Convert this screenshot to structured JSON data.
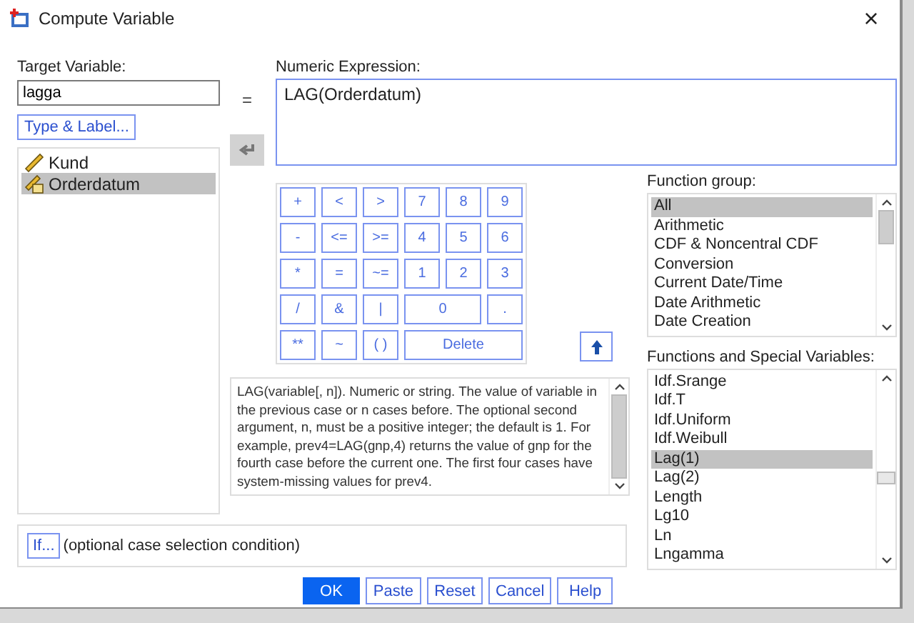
{
  "window": {
    "title": "Compute Variable",
    "close": "×"
  },
  "target": {
    "label": "Target Variable:",
    "value": "lagga"
  },
  "type_label_button": "Type & Label...",
  "variables": [
    {
      "name": "Kund",
      "kind": "scale",
      "selected": false
    },
    {
      "name": "Orderdatum",
      "kind": "date",
      "selected": true
    }
  ],
  "equals": "=",
  "expression": {
    "label": "Numeric Expression:",
    "value": "LAG(Orderdatum)"
  },
  "keypad": [
    {
      "label": "+",
      "kind": "single"
    },
    {
      "label": "<",
      "kind": "single"
    },
    {
      "label": ">",
      "kind": "single"
    },
    {
      "label": "7",
      "kind": "single"
    },
    {
      "label": "8",
      "kind": "single"
    },
    {
      "label": "9",
      "kind": "single"
    },
    {
      "label": "-",
      "kind": "single"
    },
    {
      "label": "<=",
      "kind": "single"
    },
    {
      "label": ">=",
      "kind": "single"
    },
    {
      "label": "4",
      "kind": "single"
    },
    {
      "label": "5",
      "kind": "single"
    },
    {
      "label": "6",
      "kind": "single"
    },
    {
      "label": "*",
      "kind": "single"
    },
    {
      "label": "=",
      "kind": "single"
    },
    {
      "label": "~=",
      "kind": "single"
    },
    {
      "label": "1",
      "kind": "single"
    },
    {
      "label": "2",
      "kind": "single"
    },
    {
      "label": "3",
      "kind": "single"
    },
    {
      "label": "/",
      "kind": "single"
    },
    {
      "label": "&",
      "kind": "single"
    },
    {
      "label": "|",
      "kind": "single"
    },
    {
      "label": "0",
      "kind": "double"
    },
    {
      "label": ".",
      "kind": "single"
    },
    {
      "label": "**",
      "kind": "single"
    },
    {
      "label": "~",
      "kind": "single"
    },
    {
      "label": "( )",
      "kind": "single"
    },
    {
      "label": "Delete",
      "kind": "triple"
    }
  ],
  "function_group": {
    "label": "Function group:",
    "items": [
      {
        "label": "All",
        "selected": true
      },
      {
        "label": "Arithmetic",
        "selected": false
      },
      {
        "label": "CDF & Noncentral CDF",
        "selected": false
      },
      {
        "label": "Conversion",
        "selected": false
      },
      {
        "label": "Current Date/Time",
        "selected": false
      },
      {
        "label": "Date Arithmetic",
        "selected": false
      },
      {
        "label": "Date Creation",
        "selected": false
      }
    ]
  },
  "functions": {
    "label": "Functions and Special Variables:",
    "items": [
      {
        "label": "Idf.Srange",
        "selected": false
      },
      {
        "label": "Idf.T",
        "selected": false
      },
      {
        "label": "Idf.Uniform",
        "selected": false
      },
      {
        "label": "Idf.Weibull",
        "selected": false
      },
      {
        "label": "Lag(1)",
        "selected": true
      },
      {
        "label": "Lag(2)",
        "selected": false
      },
      {
        "label": "Length",
        "selected": false
      },
      {
        "label": "Lg10",
        "selected": false
      },
      {
        "label": "Ln",
        "selected": false
      },
      {
        "label": "Lngamma",
        "selected": false
      }
    ]
  },
  "description": "LAG(variable[, n]). Numeric or string. The value of variable in the previous case or n cases before. The optional second argument, n, must be a positive integer; the default is 1. For example, prev4=LAG(gnp,4) returns the value of gnp for the fourth case before the current one. The first four cases have system-missing values for prev4.",
  "if_button": "If...",
  "if_condition": "(optional case selection condition)",
  "buttons": [
    {
      "label": "OK",
      "kind": "default"
    },
    {
      "label": "Paste",
      "kind": "normal"
    },
    {
      "label": "Reset",
      "kind": "normal"
    },
    {
      "label": "Cancel",
      "kind": "normal"
    },
    {
      "label": "Help",
      "kind": "normal"
    }
  ]
}
